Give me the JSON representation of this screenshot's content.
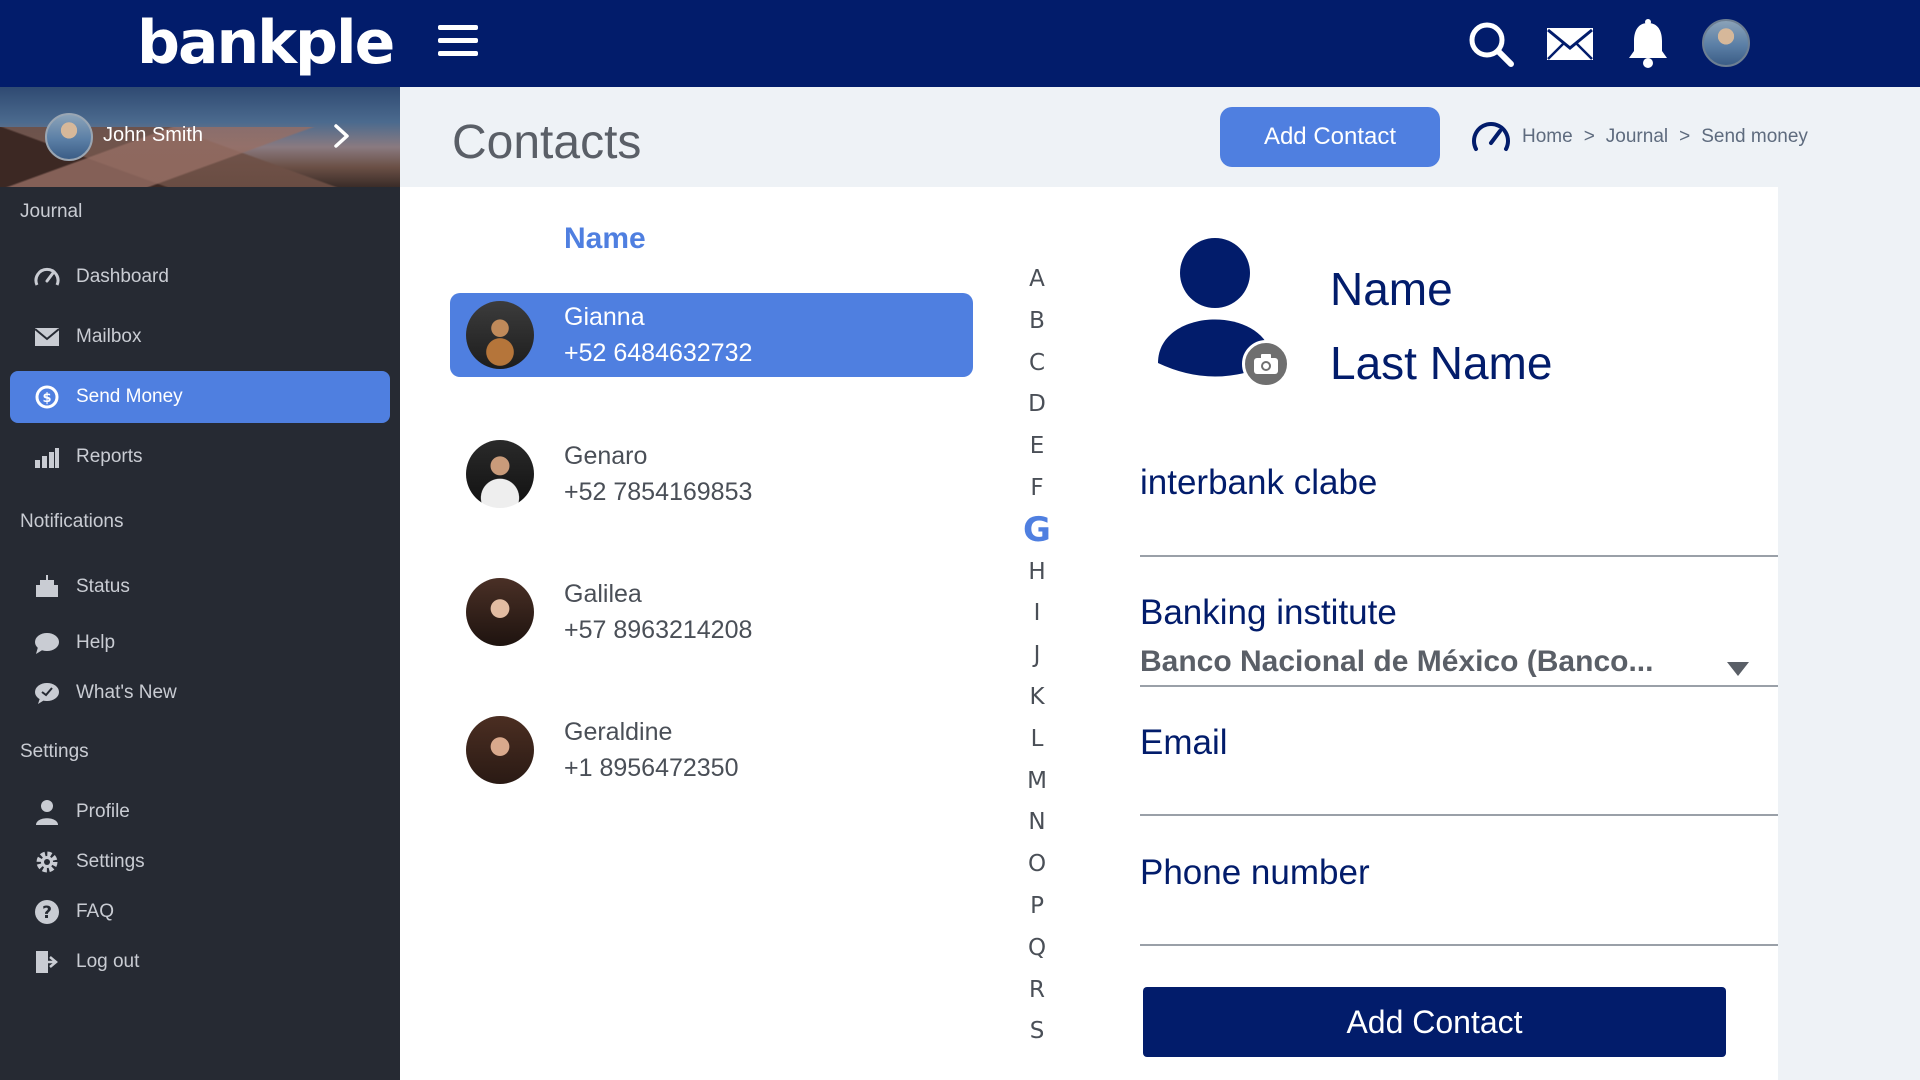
{
  "brand": {
    "logo_text": "bankple"
  },
  "topbar": {
    "icons": [
      "menu-icon",
      "search-icon",
      "mail-icon",
      "bell-icon",
      "avatar"
    ]
  },
  "sidebar": {
    "user_name": "John Smith",
    "sections": [
      {
        "title": "Journal",
        "items": [
          {
            "label": "Dashboard",
            "icon": "gauge-icon"
          },
          {
            "label": "Mailbox",
            "icon": "mail-icon"
          },
          {
            "label": "Send Money",
            "icon": "money-icon",
            "active": true
          },
          {
            "label": "Reports",
            "icon": "chart-icon"
          }
        ]
      },
      {
        "title": "Notifications",
        "items": [
          {
            "label": "Status",
            "icon": "status-icon"
          },
          {
            "label": "Help",
            "icon": "chat-icon"
          },
          {
            "label": "What's New",
            "icon": "whats-new-icon"
          }
        ]
      },
      {
        "title": "Settings",
        "items": [
          {
            "label": "Profile",
            "icon": "person-icon"
          },
          {
            "label": "Settings",
            "icon": "gear-icon"
          },
          {
            "label": "FAQ",
            "icon": "question-icon"
          },
          {
            "label": "Log out",
            "icon": "logout-icon"
          }
        ]
      }
    ]
  },
  "header": {
    "title": "Contacts",
    "add_contact_label": "Add Contact",
    "breadcrumb": [
      "Home",
      "Journal",
      "Send money"
    ],
    "breadcrumb_separator": ">"
  },
  "contacts": {
    "column_header": "Name",
    "items": [
      {
        "name": "Gianna",
        "phone": "+52 6484632732",
        "selected": true
      },
      {
        "name": "Genaro",
        "phone": "+52 7854169853"
      },
      {
        "name": "Galilea",
        "phone": "+57 8963214208"
      },
      {
        "name": "Geraldine",
        "phone": "+1 8956472350"
      }
    ]
  },
  "alphabet": {
    "letters": [
      "A",
      "B",
      "C",
      "D",
      "E",
      "F",
      "G",
      "H",
      "I",
      "J",
      "K",
      "L",
      "M",
      "N",
      "O",
      "P",
      "Q",
      "R",
      "S"
    ],
    "active": "G"
  },
  "form": {
    "name_label": "Name",
    "last_name_label": "Last Name",
    "clabe_label": "interbank clabe",
    "bank_label": "Banking institute",
    "bank_value": "Banco Nacional de México (Banco...",
    "email_label": "Email",
    "phone_label": "Phone number",
    "submit_label": "Add Contact"
  },
  "colors": {
    "navy": "#021c6b",
    "accent": "#4f7fe0",
    "sidebar_bg": "#262a33",
    "header_bg": "#eef2f6"
  }
}
